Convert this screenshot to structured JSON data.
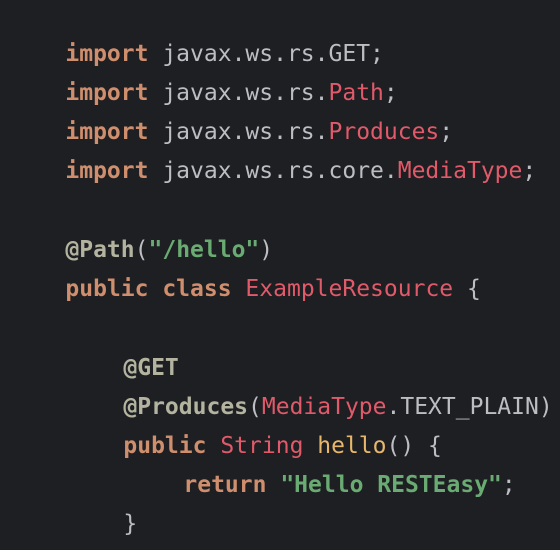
{
  "lines": [
    {
      "k": "import",
      "p": " javax.ws.rs.",
      "c": "GET",
      "e": ";"
    },
    {
      "k": "import",
      "p": " javax.ws.rs.",
      "c": "Path",
      "e": ";"
    },
    {
      "k": "import",
      "p": " javax.ws.rs.",
      "c": "Produces",
      "e": ";"
    },
    {
      "k": "import",
      "p": " javax.ws.rs.core.",
      "c": "MediaType",
      "e": ";"
    }
  ],
  "path_annotation": {
    "name": "@Path",
    "open": "(",
    "value": "\"/hello\"",
    "close": ")"
  },
  "class_decl": {
    "kw1": "public",
    "kw2": " class",
    "name": " ExampleResource",
    "brace": " {"
  },
  "get_annotation": "@GET",
  "produces_annotation": {
    "name": "@Produces",
    "open": "(",
    "type": "MediaType",
    "dot": ".",
    "const": "TEXT_PLAIN",
    "close": ")"
  },
  "method_decl": {
    "kw": "public",
    "type": " String",
    "name": " hello",
    "rest": "() {"
  },
  "return_stmt": {
    "kw": "return",
    "value": " \"Hello RESTEasy\"",
    "end": ";"
  },
  "method_close": "}",
  "class_close": "}",
  "colors": {
    "background": "#1e1f22",
    "keyword": "#cf8e6d",
    "class_ref": "#e05a6a",
    "string": "#6aab73",
    "default": "#bcbec4"
  }
}
